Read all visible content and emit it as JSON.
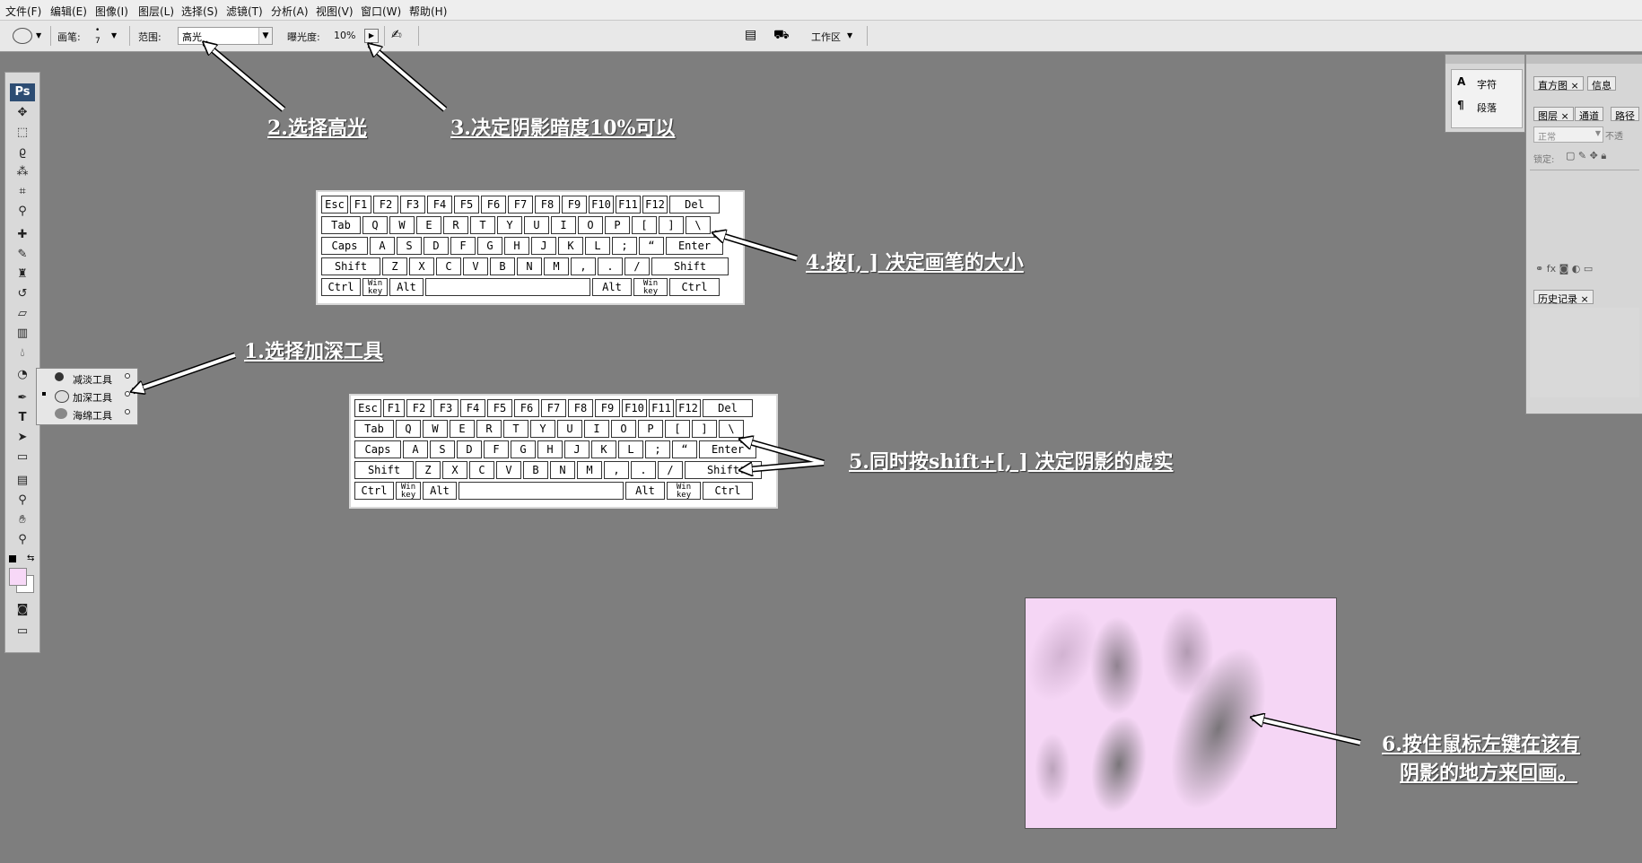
{
  "menu": [
    "文件(F)",
    "编辑(E)",
    "图像(I)",
    "图层(L)",
    "选择(S)",
    "滤镜(T)",
    "分析(A)",
    "视图(V)",
    "窗口(W)",
    "帮助(H)"
  ],
  "options": {
    "brush_label": "画笔:",
    "brush_size": "7",
    "range_label": "范围:",
    "range_value": "高光",
    "exposure_label": "曝光度:",
    "exposure_value": "10%",
    "workspace": "工作区"
  },
  "flyout": {
    "items": [
      {
        "label": "减淡工具"
      },
      {
        "label": "加深工具"
      },
      {
        "label": "海绵工具"
      }
    ]
  },
  "panels": {
    "char_label": "字符",
    "para_label": "段落",
    "tab_histogram": "直方图",
    "tab_info": "信息",
    "tab_layers": "图层",
    "tab_channels": "通道",
    "tab_paths": "路径",
    "blend_mode": "正常",
    "opacity_label": "不透",
    "lock_label": "锁定:",
    "tab_history": "历史记录"
  },
  "keyboard": {
    "row1": [
      "Esc",
      "F1",
      "F2",
      "F3",
      "F4",
      "F5",
      "F6",
      "F7",
      "F8",
      "F9",
      "F10",
      "F11",
      "F12",
      "Del"
    ],
    "row2": [
      "Tab",
      "Q",
      "W",
      "E",
      "R",
      "T",
      "Y",
      "U",
      "I",
      "O",
      "P",
      "[",
      "]",
      "\\"
    ],
    "row3": [
      "Caps",
      "A",
      "S",
      "D",
      "F",
      "G",
      "H",
      "J",
      "K",
      "L",
      ";",
      "“",
      "Enter"
    ],
    "row4": [
      "Shift",
      "Z",
      "X",
      "C",
      "V",
      "B",
      "N",
      "M",
      ",",
      ".",
      "/",
      "Shift"
    ],
    "row5": [
      "Ctrl",
      "Win key",
      "Alt",
      "",
      "Alt",
      "Win key",
      "Ctrl"
    ]
  },
  "annotations": {
    "a1": "1.选择加深工具",
    "a2": "2.选择高光",
    "a3": "3.决定阴影暗度10%可以",
    "a4": "4.按[, ] 决定画笔的大小",
    "a5": "5.同时按shift+[, ] 决定阴影的虚实",
    "a6_line1": "6.按住鼠标左键在该有",
    "a6_line2": "阴影的地方来回画。"
  },
  "colors": {
    "background": "#7e7e7e",
    "canvas": "#f5d6f5",
    "annotation_text": "#ffffff"
  }
}
